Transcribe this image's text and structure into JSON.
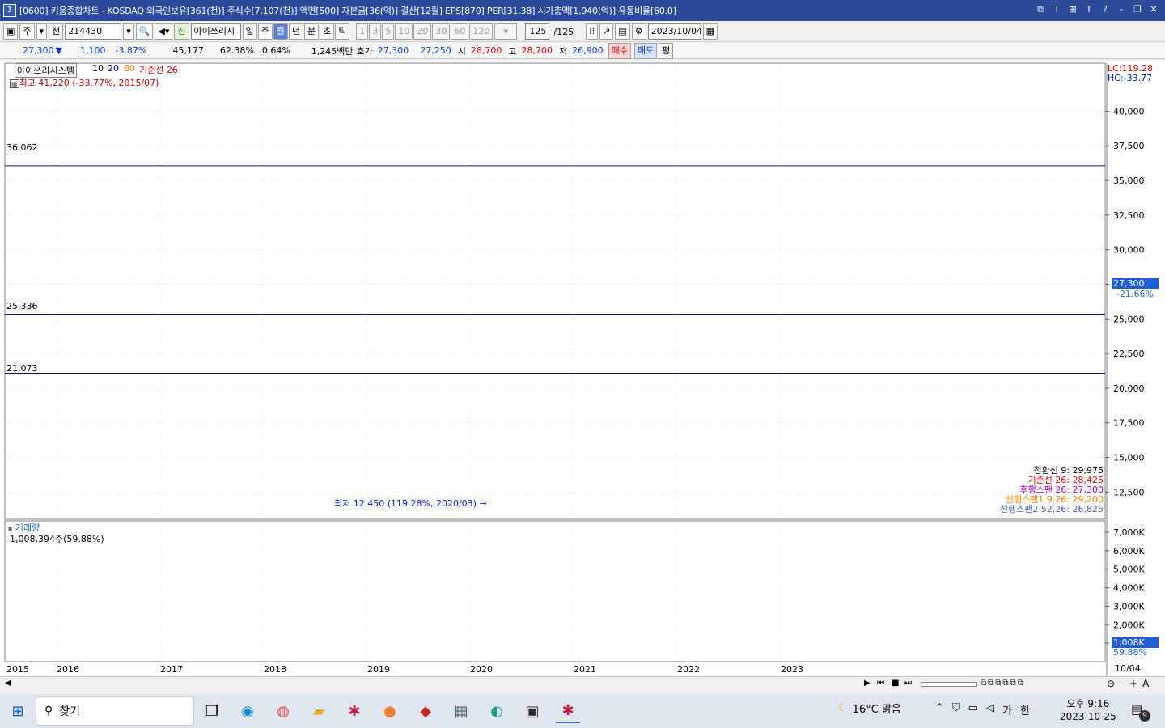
{
  "window": {
    "number": "1",
    "title": "[0600] 키움종합차트 - KOSDAQ 외국인보유[361(천)] 주식수[7,107(천)] 액면[500] 자본금[36(억)] 결산[12월] EPS[870] PER[31.38] 시가총액[1,940(억)] 유통비율[60.0]"
  },
  "toolbar": {
    "period_label": "주",
    "all_label": "전",
    "code_value": "214430",
    "new_badge": "신",
    "stock_name": "아이쓰리시",
    "period_buttons": [
      "일",
      "주",
      "월",
      "년",
      "분",
      "초",
      "틱"
    ],
    "selected_period": "월",
    "minute_buttons": [
      "1",
      "3",
      "5",
      "10",
      "20",
      "30",
      "60",
      "120"
    ],
    "count_value": "125",
    "count_total": "/125",
    "date_value": "2023/10/04"
  },
  "quote": {
    "price": "27,300",
    "change_arrow": "▼",
    "change": "1,100",
    "change_pct": "-3.87%",
    "volume": "45,177",
    "ratio1": "62.38%",
    "ratio2": "0.64%",
    "amount": "1,245백만",
    "bid_label": "호가",
    "bid1": "27,300",
    "bid2": "27,250",
    "open_label": "시",
    "open": "28,700",
    "high_label": "고",
    "high": "28,700",
    "low_label": "저",
    "low": "26,900",
    "buy_button": "매수",
    "sell_button": "매도",
    "avg_button": "평"
  },
  "chart_data": {
    "type": "candlestick",
    "title": "아이쓰리시스템",
    "ma_legend": [
      "10",
      "20",
      "60",
      "기준선 26"
    ],
    "max_note": "최고 41,220 (-33.77%, 2015/07)",
    "min_note": "최저 12,450 (119.28%, 2020/03)",
    "lc_label": "LC:119.28",
    "hc_label": "HC:-33.77",
    "hlines": [
      36062,
      25336,
      21073
    ],
    "hline_labels": [
      "36,062",
      "25,336",
      "21,073"
    ],
    "current_price_label": "27,300",
    "current_pct_label": "-21.66%",
    "y_ticks": [
      12500,
      15000,
      17500,
      20000,
      22500,
      25000,
      27500,
      30000,
      32500,
      35000,
      37500,
      40000
    ],
    "y_tick_labels": [
      "12,500",
      "15,000",
      "17,500",
      "20,000",
      "22,500",
      "25,000",
      "27,500",
      "30,000",
      "32,500",
      "35,000",
      "37,500",
      "40,000"
    ],
    "ylim": [
      11000,
      43000
    ],
    "x_labels": [
      "2015",
      "2016",
      "2017",
      "2018",
      "2019",
      "2020",
      "2021",
      "2022",
      "2023"
    ],
    "ichimoku_legend": [
      {
        "label": "전환선 9: 29,975",
        "color": "#000000"
      },
      {
        "label": "기준선 26: 28,425",
        "color": "#e00000"
      },
      {
        "label": "후행스팬 26: 27,300",
        "color": "#a000c0"
      },
      {
        "label": "선행스팬1 9,26: 29,200",
        "color": "#f08000"
      },
      {
        "label": "선행스팬2 52,26: 26,825",
        "color": "#4060c0"
      }
    ],
    "volume_title": "거래량",
    "volume_note": "1,008,394주(59.88%)",
    "volume_ticks": [
      "1,000K",
      "2,000K",
      "3,000K",
      "4,000K",
      "5,000K",
      "6,000K",
      "7,000K"
    ],
    "volume_current_label": "1,008K",
    "volume_pct_label": "59.88%",
    "last_date_label": "10/04"
  },
  "taskbar": {
    "search_label": "찾기",
    "weather": "16°C 맑음",
    "ime": "가",
    "lang": "한",
    "time": "오후 9:16",
    "date": "2023-10-25",
    "notif_count": "9"
  },
  "colors": {
    "up": "#ff2020",
    "down": "#1e5fd8",
    "titlebar": "#2c4a9a"
  }
}
